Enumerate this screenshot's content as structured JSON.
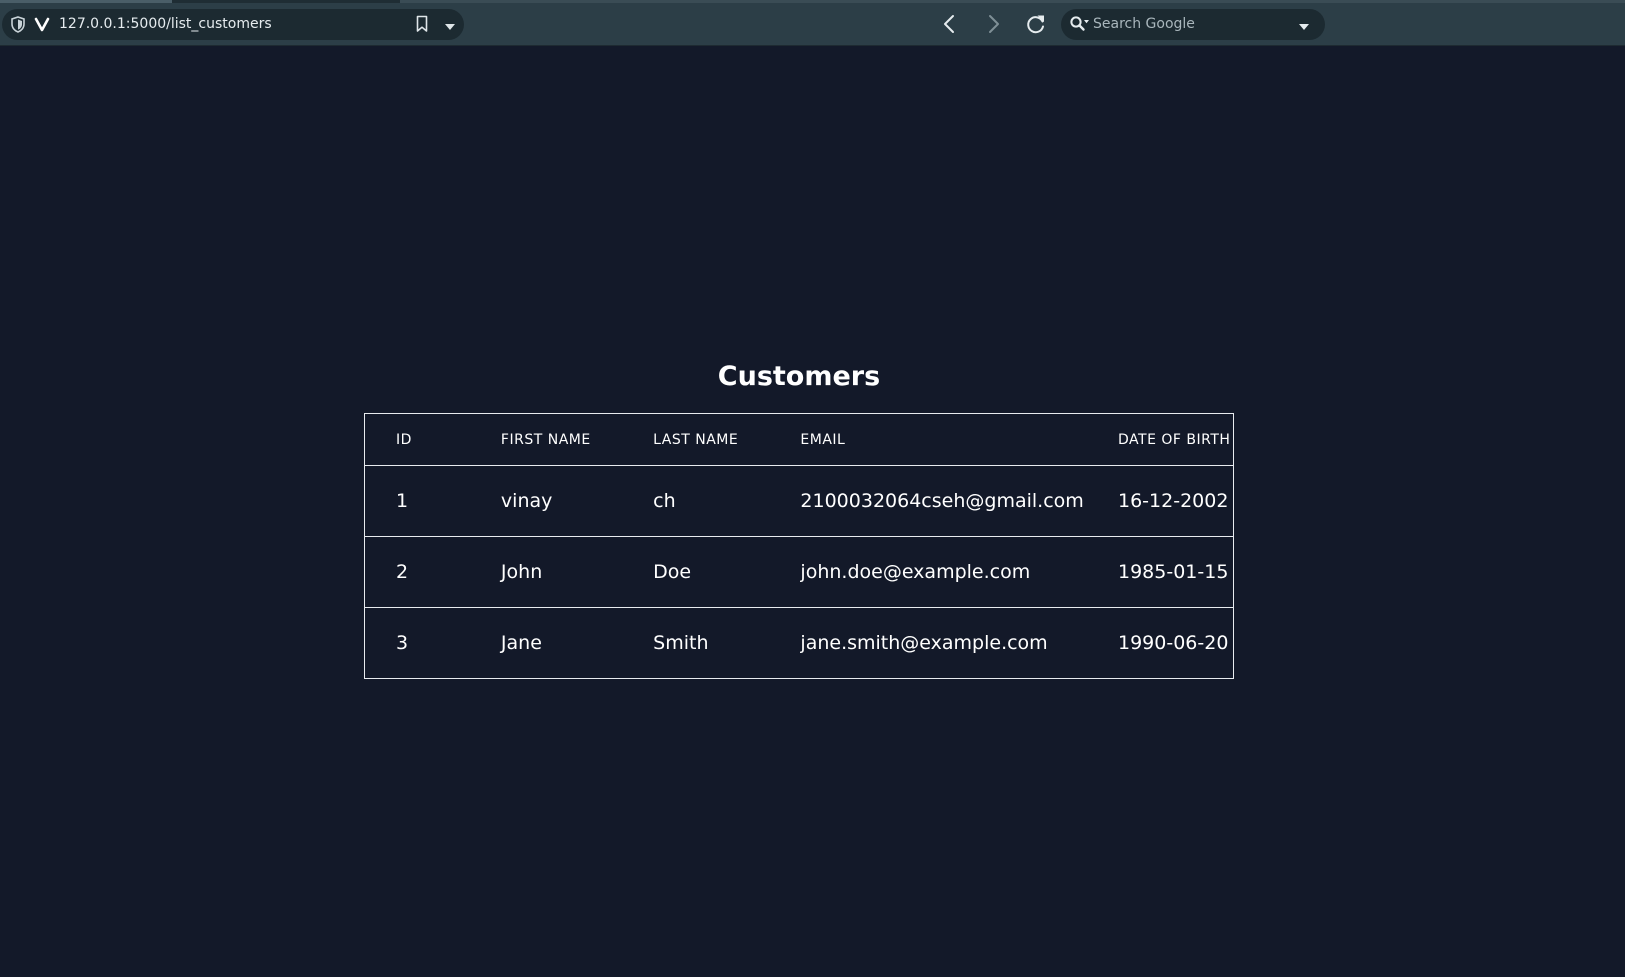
{
  "browser": {
    "url": "127.0.0.1:5000/list_customers",
    "search_placeholder": "Search Google"
  },
  "page": {
    "title": "Customers"
  },
  "table": {
    "columns": [
      "ID",
      "FIRST NAME",
      "LAST NAME",
      "EMAIL",
      "DATE OF BIRTH"
    ],
    "rows": [
      [
        "1",
        "vinay",
        "ch",
        "2100032064cseh@gmail.com",
        "16-12-2002"
      ],
      [
        "2",
        "John",
        "Doe",
        "john.doe@example.com",
        "1985-01-15"
      ],
      [
        "3",
        "Jane",
        "Smith",
        "jane.smith@example.com",
        "1990-06-20"
      ]
    ]
  },
  "colors": {
    "page_background": "#131929",
    "toolbar_background": "#2c3e47",
    "field_background": "#1c2a31",
    "text": "#ffffff",
    "table_border": "#e8ebef"
  },
  "icons": {
    "shield": "shield-icon",
    "logo": "v-logo-icon",
    "bookmark": "bookmark-icon",
    "dropdown": "chevron-down-icon",
    "back": "chevron-left-icon",
    "forward": "chevron-right-icon",
    "reload": "reload-icon",
    "search": "search-icon"
  }
}
